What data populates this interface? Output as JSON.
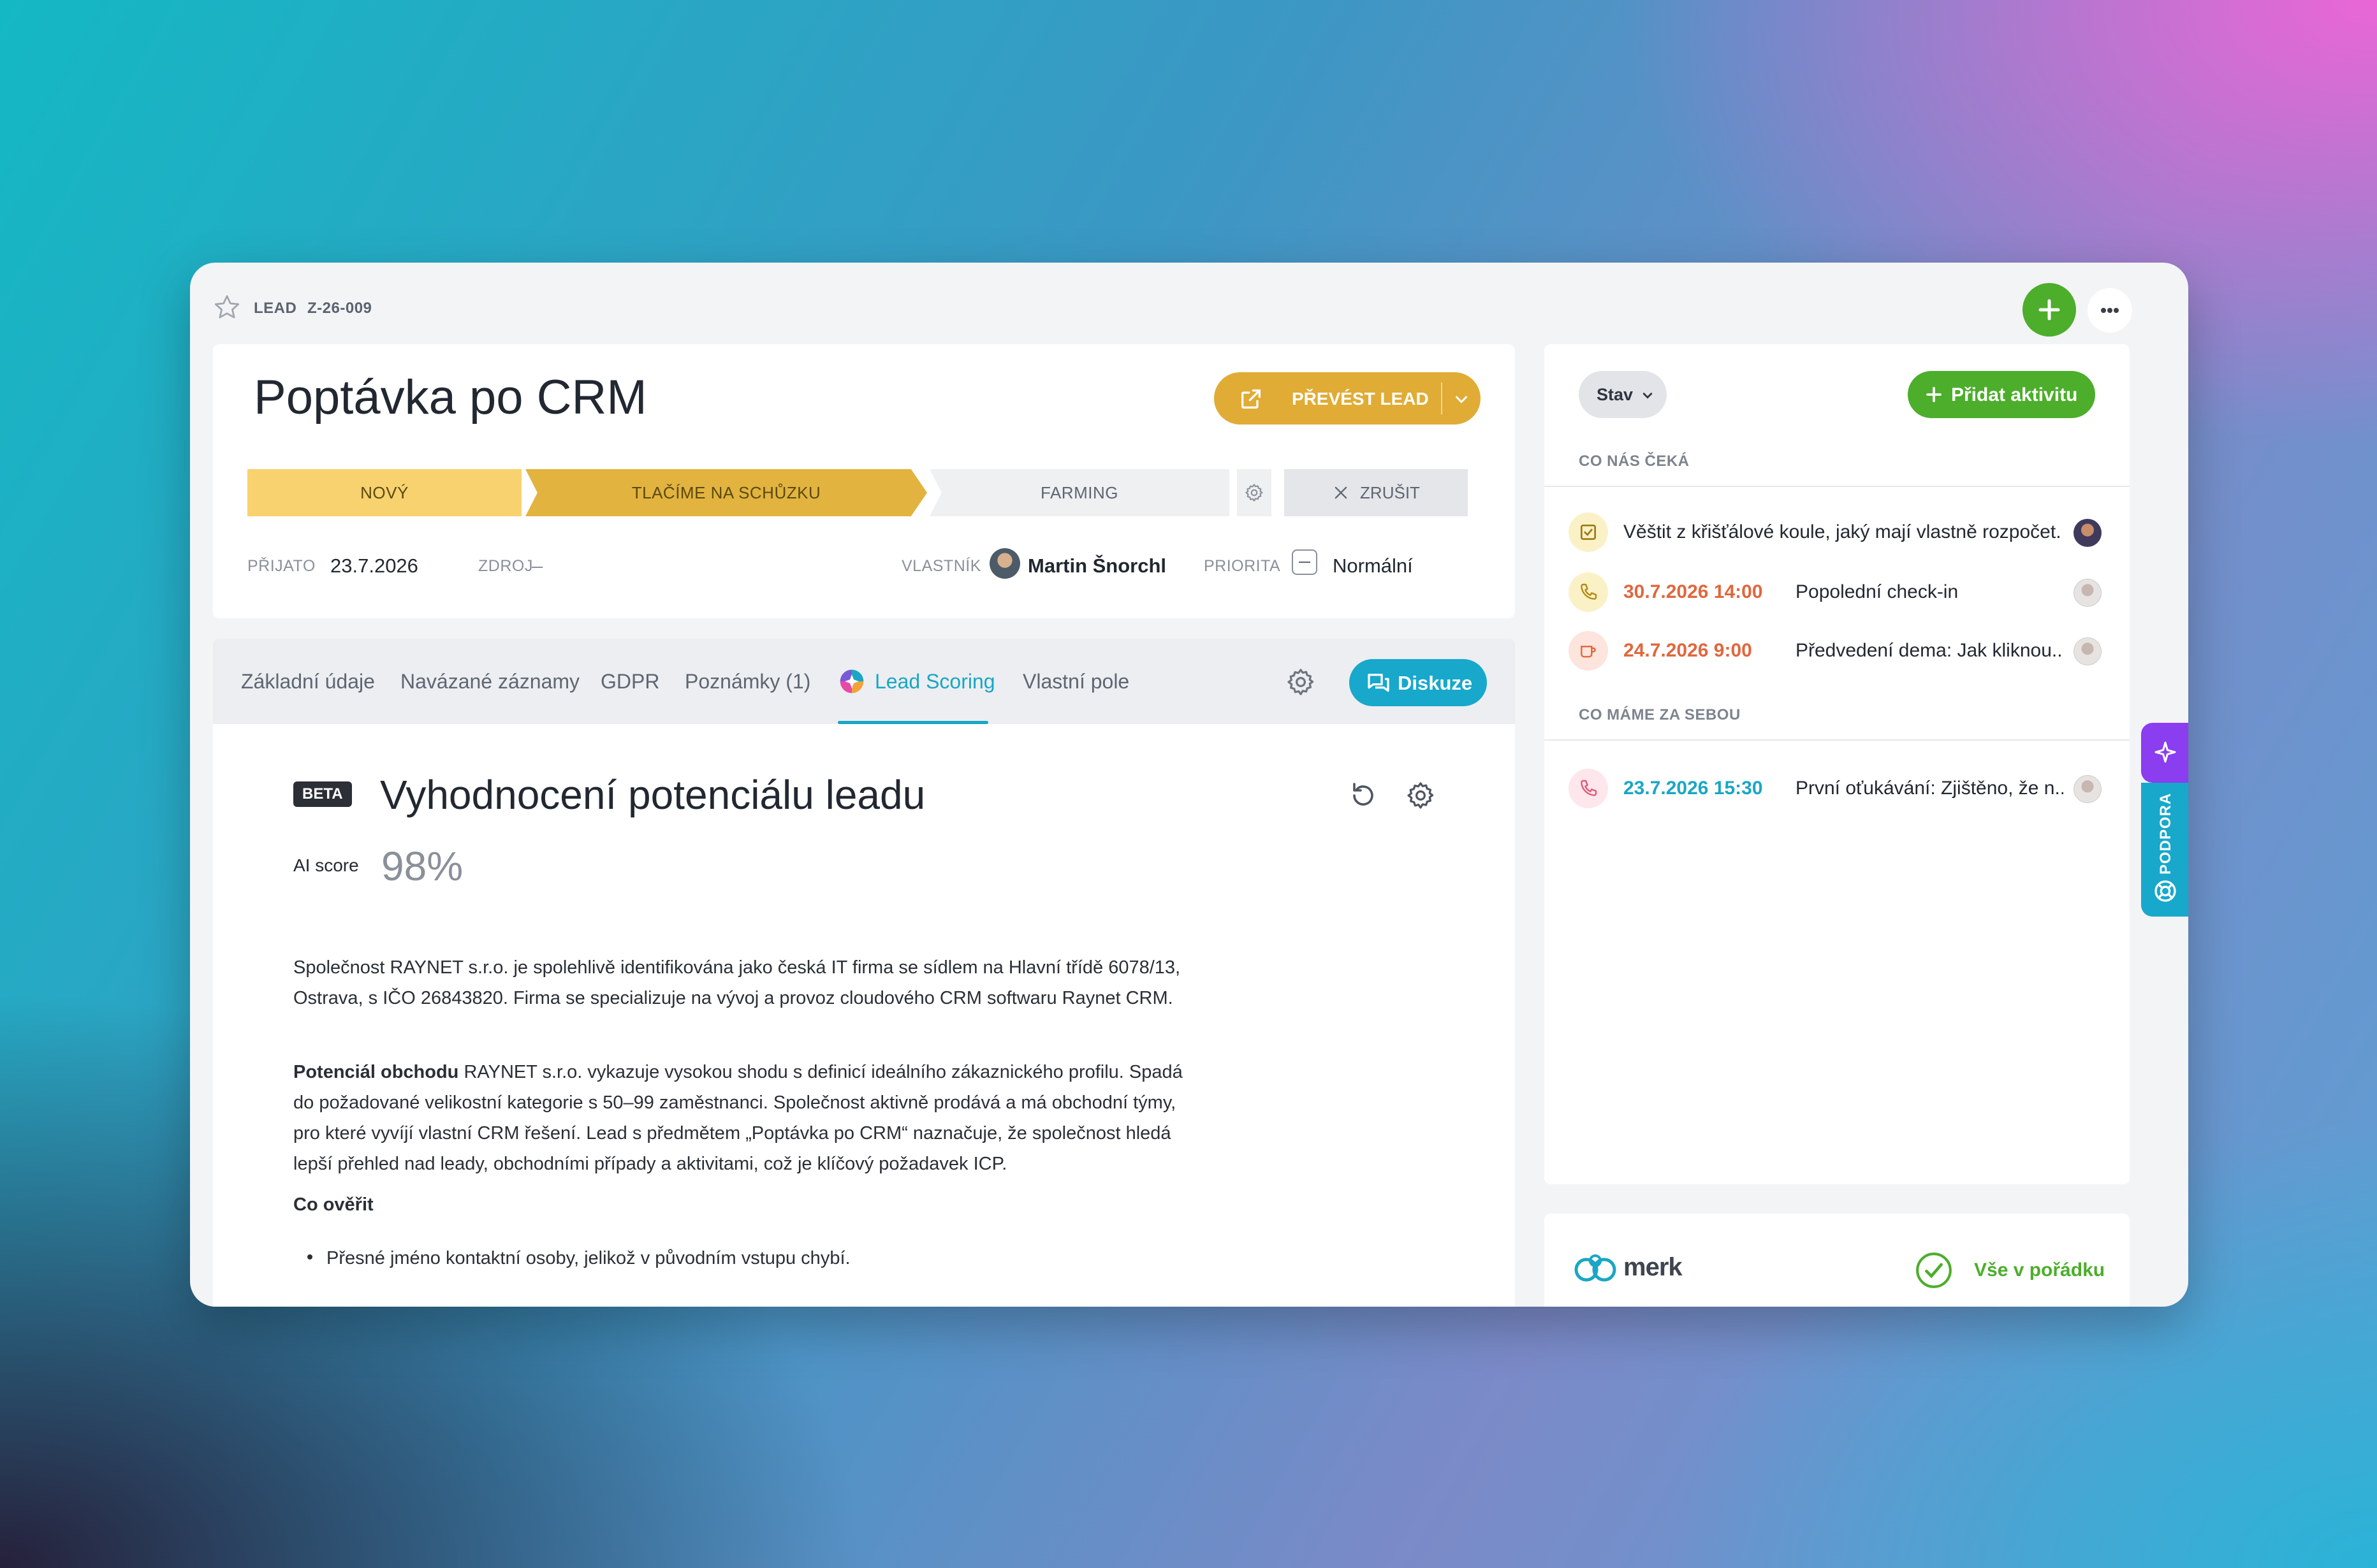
{
  "breadcrumb": {
    "type": "LEAD",
    "code": "Z-26-009"
  },
  "lead": {
    "title": "Poptávka po CRM",
    "convert_label": "PŘEVÉST LEAD"
  },
  "stages": [
    {
      "label": "NOVÝ"
    },
    {
      "label": "TLAČÍME NA SCHŮZKU"
    },
    {
      "label": "FARMING"
    }
  ],
  "cancel_label": "ZRUŠIT",
  "meta": {
    "received_label": "PŘIJATO",
    "received_value": "23.7.2026",
    "source_label": "ZDROJ",
    "source_value": "–",
    "owner_label": "VLASTNÍK",
    "owner_value": "Martin Šnorchl",
    "priority_label": "PRIORITA",
    "priority_value": "Normální"
  },
  "tabs": [
    {
      "label": "Základní údaje"
    },
    {
      "label": "Navázané záznamy"
    },
    {
      "label": "GDPR"
    },
    {
      "label": "Poznámky (1)"
    },
    {
      "label": "Lead Scoring"
    },
    {
      "label": "Vlastní pole"
    }
  ],
  "active_tab": "Lead Scoring",
  "discuss_label": "Diskuze",
  "scoring": {
    "badge": "BETA",
    "heading": "Vyhodnocení potenciálu leadu",
    "ai_label": "AI score",
    "ai_value": "98%",
    "p1": "Společnost RAYNET s.r.o. je spolehlivě identifikována jako česká IT firma se sídlem na Hlavní třídě 6078/13, Ostrava, s IČO 26843820. Firma se specializuje na vývoj a provoz cloudového CRM softwaru Raynet CRM.",
    "p2_bold": "Potenciál obchodu",
    "p2": " RAYNET s.r.o. vykazuje vysokou shodu s definicí ideálního zákaznického profilu. Spadá do požadované velikostní kategorie s 50–99 zaměstnanci. Společnost aktivně prodává a má obchodní týmy, pro které vyvíjí vlastní CRM řešení. Lead s předmětem „Poptávka po CRM“ naznačuje, že společnost hledá lepší přehled nad leady, obchodními případy a aktivitami, což je klíčový požadavek ICP.",
    "verify_heading": "Co ověřit",
    "verify_items": [
      "Přesné jméno kontaktní osoby, jelikož v původním vstupu chybí."
    ]
  },
  "activities": {
    "filter_label": "Stav",
    "add_label": "Přidat aktivitu",
    "upcoming_label": "CO NÁS ČEKÁ",
    "upcoming": [
      {
        "date": "",
        "text": "Věštit z křišťálové koule, jaký mají vlastně rozpočet."
      },
      {
        "date": "30.7.2026 14:00",
        "text": "Popolední check-in"
      },
      {
        "date": "24.7.2026 9:00",
        "text": "Předvedení dema: Jak kliknou..."
      }
    ],
    "past_label": "CO MÁME ZA SEBOU",
    "past": [
      {
        "date": "23.7.2026 15:30",
        "text": "První oťukávání: Zjištěno, že n..."
      }
    ]
  },
  "merk": {
    "logo": "merk",
    "status": "Vše v pořádku"
  },
  "support_label": "PODPORA",
  "colors": {
    "accent": "#1aa6c4",
    "convert": "#e0ac35",
    "green": "#4cae2b",
    "overdue": "#e0673e",
    "past": "#1aa6c4"
  }
}
